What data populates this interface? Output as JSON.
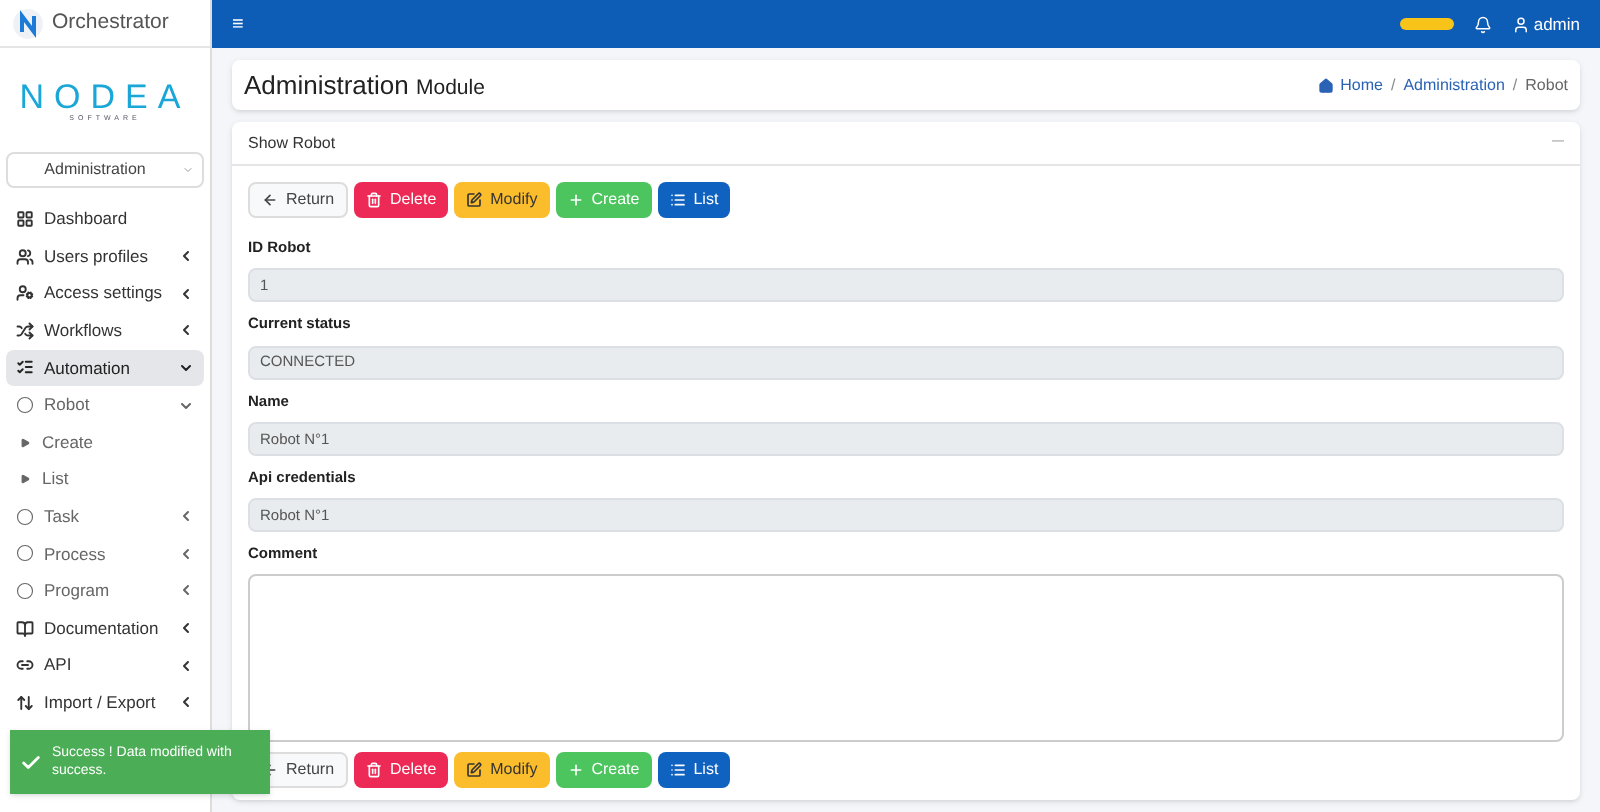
{
  "brand": {
    "title": "Orchestrator",
    "logo_text": "NODEA",
    "logo_subtext": "SOFTWARE"
  },
  "module_select": {
    "value": "Administration"
  },
  "sidebar": {
    "items": [
      {
        "label": "Dashboard",
        "kind": "section",
        "selected": false
      },
      {
        "label": "Users profiles",
        "kind": "section",
        "expanded": false,
        "selected": false
      },
      {
        "label": "Access settings",
        "kind": "section",
        "expanded": false,
        "selected": false
      },
      {
        "label": "Workflows",
        "kind": "section",
        "expanded": false,
        "selected": false
      },
      {
        "label": "Automation",
        "kind": "section",
        "expanded": true,
        "selected": true,
        "children": [
          {
            "label": "Robot",
            "kind": "group",
            "expanded": true,
            "selected": false,
            "children": [
              {
                "label": "Create",
                "kind": "leaf",
                "selected": false
              },
              {
                "label": "List",
                "kind": "leaf",
                "selected": false
              }
            ]
          },
          {
            "label": "Task",
            "kind": "group",
            "expanded": false,
            "selected": false
          },
          {
            "label": "Process",
            "kind": "group",
            "expanded": false,
            "selected": false
          },
          {
            "label": "Program",
            "kind": "group",
            "expanded": false,
            "selected": false
          }
        ]
      },
      {
        "label": "Documentation",
        "kind": "section",
        "expanded": false,
        "selected": false
      },
      {
        "label": "API",
        "kind": "section",
        "expanded": false,
        "selected": false
      },
      {
        "label": "Import / Export",
        "kind": "section",
        "expanded": false,
        "selected": false
      }
    ]
  },
  "topbar": {
    "menu_glyph": "≡",
    "user": "admin"
  },
  "page_header": {
    "title": "Administration",
    "subtitle": "Module",
    "breadcrumb": [
      "Home",
      "Administration",
      "Robot"
    ],
    "separators": [
      "/",
      "/"
    ]
  },
  "card": {
    "title": "Show Robot",
    "collapse_glyph": "—"
  },
  "actions_top": [
    {
      "label": "Return",
      "kind": "return"
    },
    {
      "label": "Delete",
      "kind": "delete"
    },
    {
      "label": "Modify",
      "kind": "modify"
    },
    {
      "label": "Create",
      "kind": "create"
    },
    {
      "label": "List",
      "kind": "list"
    }
  ],
  "fields": [
    {
      "label": "ID Robot",
      "value": "1",
      "kind": "input"
    },
    {
      "label": "Current status",
      "value": "CONNECTED",
      "kind": "input"
    },
    {
      "label": "Name",
      "value": "Robot N°1",
      "kind": "input"
    },
    {
      "label": "Api credentials",
      "value": "Robot N°1",
      "kind": "input"
    },
    {
      "label": "Comment",
      "kind": "textarea"
    }
  ],
  "actions_bottom": [
    {
      "label": "Return",
      "kind": "return"
    },
    {
      "label": "Delete",
      "kind": "delete"
    },
    {
      "label": "Modify",
      "kind": "modify"
    },
    {
      "label": "Create",
      "kind": "create"
    },
    {
      "label": "List",
      "kind": "list"
    }
  ],
  "toast": {
    "message": "Success ! Data modified with success."
  }
}
